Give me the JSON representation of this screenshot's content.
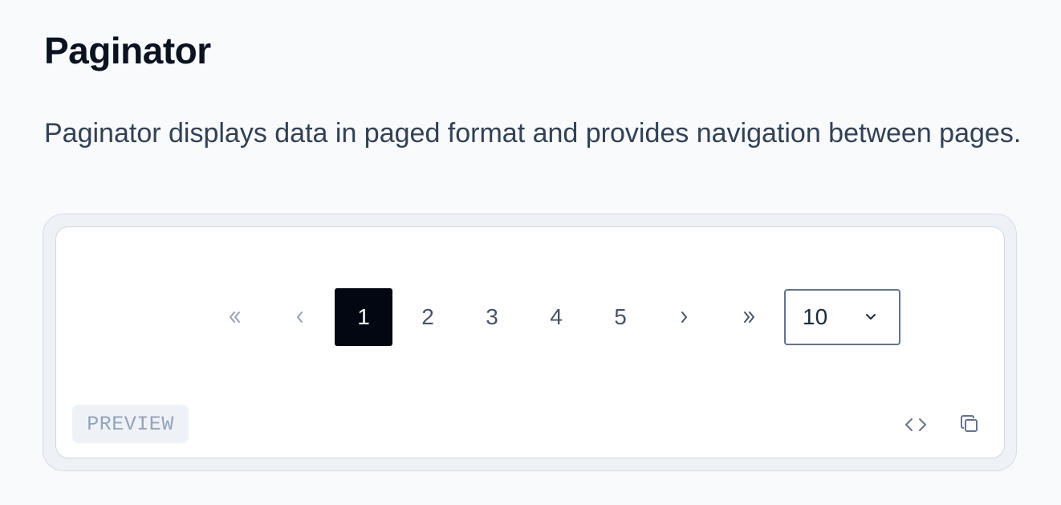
{
  "header": {
    "title": "Paginator",
    "description": "Paginator displays data in paged format and provides navigation between pages."
  },
  "paginator": {
    "first_icon": "double-chevron-left-icon",
    "prev_icon": "chevron-left-icon",
    "pages": [
      "1",
      "2",
      "3",
      "4",
      "5"
    ],
    "active_page": "1",
    "next_icon": "chevron-right-icon",
    "last_icon": "double-chevron-right-icon",
    "rows_per_page": "10",
    "dropdown_icon": "chevron-down-icon"
  },
  "preview": {
    "badge": "PREVIEW",
    "code_icon": "code-icon",
    "copy_icon": "copy-icon"
  },
  "colors": {
    "background": "#f8fafc",
    "active_page": "#030712",
    "text": "#0b1220",
    "muted": "#94a3b8"
  }
}
